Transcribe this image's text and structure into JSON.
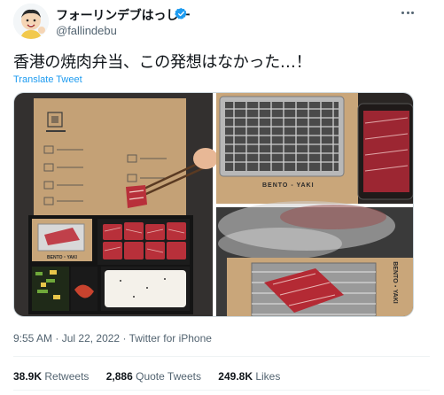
{
  "author": {
    "display_name": "フォーリンデブはっしー",
    "handle": "@fallindebu"
  },
  "tweet": {
    "text": "香港の焼肉弁当、この発想はなかった…！",
    "translate_label": "Translate Tweet",
    "time": "9:55 AM",
    "date": "Jul 22, 2022",
    "source": "Twitter for iPhone"
  },
  "media": {
    "box_label": "BENTO・YAKI",
    "tray_label": "BENTO - YAKI",
    "smoke_label": "BENTO・YAKI"
  },
  "stats": {
    "retweets_count": "38.9K",
    "retweets_label": "Retweets",
    "quotes_count": "2,886",
    "quotes_label": "Quote Tweets",
    "likes_count": "249.8K",
    "likes_label": "Likes"
  },
  "colors": {
    "accent": "#1d9bf0",
    "text": "#0f1419",
    "muted": "#536471",
    "border": "#eff3f4"
  },
  "icons": {
    "verified": "verified-badge-icon",
    "more": "more-icon"
  }
}
